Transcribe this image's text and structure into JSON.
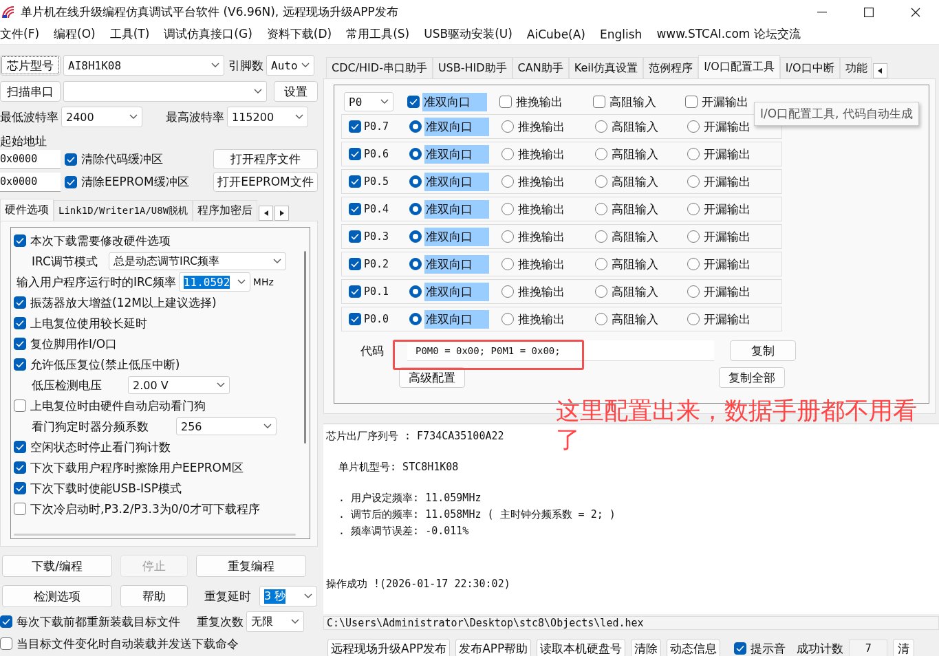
{
  "window": {
    "title": "单片机在线升级编程仿真调试平台软件 (V6.96N), 远程现场升级APP发布"
  },
  "menu": [
    "文件(F)",
    "编程(O)",
    "工具(T)",
    "调试仿真接口(G)",
    "资料下载(D)",
    "常用工具(S)",
    "USB驱动安装(U)",
    "AiCube(A)",
    "English",
    "www.STCAI.com 论坛交流"
  ],
  "chip": {
    "button": "芯片型号",
    "value": "AI8H1K08",
    "pins_label": "引脚数",
    "pins_value": "Auto"
  },
  "port": {
    "scan_button": "扫描串口",
    "settings_button": "设置"
  },
  "baud": {
    "min_label": "最低波特率",
    "min_value": "2400",
    "max_label": "最高波特率",
    "max_value": "115200"
  },
  "start_address": {
    "label": "起始地址",
    "code_address": "0x0000",
    "eeprom_address": "0x0000"
  },
  "clear_options": [
    {
      "label": "清除代码缓冲区",
      "checked": true,
      "button": "打开程序文件"
    },
    {
      "label": "清除EEPROM缓冲区",
      "checked": true,
      "button": "打开EEPROM文件"
    }
  ],
  "left_tabs": [
    {
      "label": "硬件选项",
      "selected": true
    },
    {
      "label": "Link1D/Writer1A/U8W脱机",
      "selected": false
    },
    {
      "label": "程序加密后",
      "selected": false
    }
  ],
  "hardware_options": [
    {
      "kind": "checkbox",
      "label": "本次下载需要修改硬件选项",
      "checked": true
    },
    {
      "kind": "select",
      "label": "IRC调节模式",
      "value": "总是动态调节IRC频率"
    },
    {
      "kind": "input",
      "label": "输入用户程序运行时的IRC频率",
      "value": "11.0592",
      "unit": "MHz"
    },
    {
      "kind": "checkbox",
      "label": "振荡器放大增益(12M以上建议选择)",
      "checked": true
    },
    {
      "kind": "checkbox",
      "label": "上电复位使用较长延时",
      "checked": true
    },
    {
      "kind": "checkbox",
      "label": "复位脚用作I/O口",
      "checked": true
    },
    {
      "kind": "checkbox",
      "label": "允许低压复位(禁止低压中断)",
      "checked": true
    },
    {
      "kind": "select",
      "label": "低压检测电压",
      "value": "2.00 V"
    },
    {
      "kind": "checkbox",
      "label": "上电复位时由硬件自动启动看门狗",
      "checked": false
    },
    {
      "kind": "select",
      "label": "看门狗定时器分频系数",
      "value": "256"
    },
    {
      "kind": "checkbox",
      "label": "空闲状态时停止看门狗计数",
      "checked": true
    },
    {
      "kind": "checkbox",
      "label": "下次下载用户程序时擦除用户EEPROM区",
      "checked": true
    },
    {
      "kind": "checkbox",
      "label": "下次下载时使能USB-ISP模式",
      "checked": true
    },
    {
      "kind": "checkbox",
      "label": "下次冷启动时,P3.2/P3.3为0/0才可下载程序",
      "checked": false
    }
  ],
  "action_buttons": [
    {
      "label": "下载/编程",
      "disabled": false
    },
    {
      "label": "停止",
      "disabled": true
    },
    {
      "label": "重复编程",
      "disabled": false
    },
    {
      "label": "检测选项",
      "disabled": false
    },
    {
      "label": "帮助",
      "disabled": false
    }
  ],
  "repeat": {
    "delay_label": "重复延时",
    "delay_value": "3 秒",
    "count_label": "重复次数",
    "count_value": "无限"
  },
  "load_options": [
    {
      "label": "每次下载前都重新装载目标文件",
      "checked": true
    },
    {
      "label": "当目标文件变化时自动装载并发送下载命令",
      "checked": false
    }
  ],
  "right_tabs": [
    {
      "label": "CDC/HID-串口助手",
      "selected": false
    },
    {
      "label": "USB-HID助手",
      "selected": false
    },
    {
      "label": "CAN助手",
      "selected": false
    },
    {
      "label": "Keil仿真设置",
      "selected": false
    },
    {
      "label": "范例程序",
      "selected": false
    },
    {
      "label": "I/O口配置工具",
      "selected": true
    },
    {
      "label": "I/O口中断",
      "selected": false
    },
    {
      "label": "功能",
      "selected": false
    }
  ],
  "io_config": {
    "port": "P0",
    "all_modes": [
      {
        "label": "准双向口",
        "checked": true
      },
      {
        "label": "推挽输出",
        "checked": false
      },
      {
        "label": "高阻输入",
        "checked": false
      },
      {
        "label": "开漏输出",
        "checked": false
      }
    ],
    "tooltip": "I/O口配置工具, 代码自动生成",
    "pins": [
      {
        "label": "P0.7",
        "checked": true,
        "modes": [
          {
            "label": "准双向口",
            "selected": true
          },
          {
            "label": "推挽输出",
            "selected": false
          },
          {
            "label": "高阻输入",
            "selected": false
          },
          {
            "label": "开漏输出",
            "selected": false
          }
        ]
      },
      {
        "label": "P0.6",
        "checked": true,
        "modes": [
          {
            "label": "准双向口",
            "selected": true
          },
          {
            "label": "推挽输出",
            "selected": false
          },
          {
            "label": "高阻输入",
            "selected": false
          },
          {
            "label": "开漏输出",
            "selected": false
          }
        ]
      },
      {
        "label": "P0.5",
        "checked": true,
        "modes": [
          {
            "label": "准双向口",
            "selected": true
          },
          {
            "label": "推挽输出",
            "selected": false
          },
          {
            "label": "高阻输入",
            "selected": false
          },
          {
            "label": "开漏输出",
            "selected": false
          }
        ]
      },
      {
        "label": "P0.4",
        "checked": true,
        "modes": [
          {
            "label": "准双向口",
            "selected": true
          },
          {
            "label": "推挽输出",
            "selected": false
          },
          {
            "label": "高阻输入",
            "selected": false
          },
          {
            "label": "开漏输出",
            "selected": false
          }
        ]
      },
      {
        "label": "P0.3",
        "checked": true,
        "modes": [
          {
            "label": "准双向口",
            "selected": true
          },
          {
            "label": "推挽输出",
            "selected": false
          },
          {
            "label": "高阻输入",
            "selected": false
          },
          {
            "label": "开漏输出",
            "selected": false
          }
        ]
      },
      {
        "label": "P0.2",
        "checked": true,
        "modes": [
          {
            "label": "准双向口",
            "selected": true
          },
          {
            "label": "推挽输出",
            "selected": false
          },
          {
            "label": "高阻输入",
            "selected": false
          },
          {
            "label": "开漏输出",
            "selected": false
          }
        ]
      },
      {
        "label": "P0.1",
        "checked": true,
        "modes": [
          {
            "label": "准双向口",
            "selected": true
          },
          {
            "label": "推挽输出",
            "selected": false
          },
          {
            "label": "高阻输入",
            "selected": false
          },
          {
            "label": "开漏输出",
            "selected": false
          }
        ]
      },
      {
        "label": "P0.0",
        "checked": true,
        "modes": [
          {
            "label": "准双向口",
            "selected": true
          },
          {
            "label": "推挽输出",
            "selected": false
          },
          {
            "label": "高阻输入",
            "selected": false
          },
          {
            "label": "开漏输出",
            "selected": false
          }
        ]
      }
    ],
    "code_label": "代码",
    "code": "P0M0 = 0x00; P0M1 = 0x00;",
    "copy_button": "复制",
    "copy_all_button": "复制全部",
    "advanced_button": "高级配置"
  },
  "annotation": "这里配置出来，数据手册都不用看了",
  "log": [
    {
      "lines": [
        "芯片出厂序列号 : F734CA35100A22"
      ]
    },
    {
      "lines": [
        "  单片机型号: STC8H1K08"
      ]
    },
    {
      "lines": [
        "  . 用户设定频率: 11.059MHz",
        "  . 调节后的频率: 11.058MHz ( 主时钟分频系数 = 2; )",
        "  . 频率调节误差: -0.011%"
      ]
    },
    {
      "lines": [
        "操作成功 !(2026-01-17 22:30:02)"
      ]
    }
  ],
  "file_path": "C:\\Users\\Administrator\\Desktop\\stc8\\Objects\\led.hex",
  "bottom_bar": {
    "buttons": [
      "远程现场升级APP发布",
      "发布APP帮助",
      "读取本机硬盘号",
      "清除",
      "动态信息"
    ],
    "beep": {
      "label": "提示音",
      "checked": true
    },
    "count_label": "成功计数",
    "count_value": "7",
    "reset_button": "清"
  }
}
